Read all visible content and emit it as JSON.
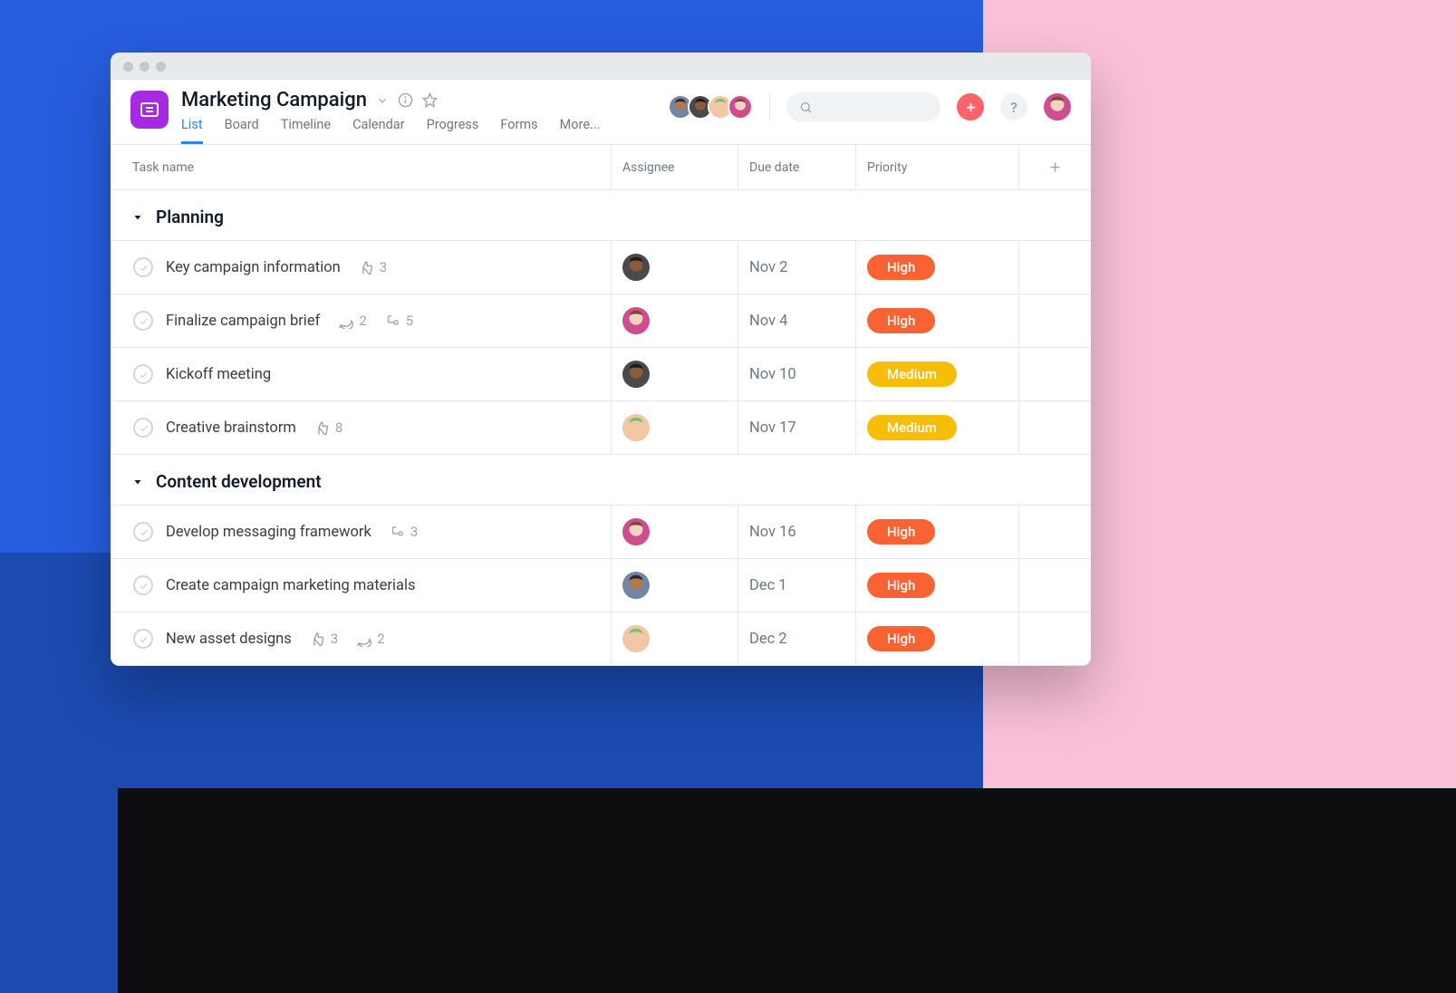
{
  "project": {
    "title": "Marketing Campaign",
    "icon_color": "#A62AE3"
  },
  "tabs": [
    {
      "label": "List",
      "active": true
    },
    {
      "label": "Board",
      "active": false
    },
    {
      "label": "Timeline",
      "active": false
    },
    {
      "label": "Calendar",
      "active": false
    },
    {
      "label": "Progress",
      "active": false
    },
    {
      "label": "Forms",
      "active": false
    },
    {
      "label": "More...",
      "active": false
    }
  ],
  "header_avatars": [
    {
      "skin": "#B17A4E",
      "shirt": "#7385A5",
      "hair": "#2F2A28"
    },
    {
      "skin": "#8A5A3A",
      "shirt": "#4A4A4A",
      "hair": "#1E1A18"
    },
    {
      "skin": "#F1C7A4",
      "shirt": "#F1C7A4",
      "hair": "#7DBF6B"
    },
    {
      "skin": "#F3D3BF",
      "shirt": "#CF4D8F",
      "hair": "#7A4A3A"
    }
  ],
  "me_avatar": {
    "skin": "#F3D3BF",
    "shirt": "#CF4D8F",
    "hair": "#7A4A3A"
  },
  "help_label": "?",
  "columns": {
    "task": "Task name",
    "assignee": "Assignee",
    "due": "Due date",
    "priority": "Priority"
  },
  "priority_colors": {
    "High": "#F96232",
    "Medium": "#F6BE06"
  },
  "sections": [
    {
      "name": "Planning",
      "tasks": [
        {
          "name": "Key campaign information",
          "likes": 3,
          "comments": null,
          "subtasks": null,
          "assignee": {
            "skin": "#8A5A3A",
            "shirt": "#4A4A4A",
            "hair": "#1E1A18"
          },
          "due": "Nov 2",
          "priority": "High"
        },
        {
          "name": "Finalize campaign brief",
          "likes": null,
          "comments": 2,
          "subtasks": 5,
          "assignee": {
            "skin": "#F3D3BF",
            "shirt": "#CF4D8F",
            "hair": "#7A4A3A"
          },
          "due": "Nov 4",
          "priority": "High"
        },
        {
          "name": "Kickoff meeting",
          "likes": null,
          "comments": null,
          "subtasks": null,
          "assignee": {
            "skin": "#8A5A3A",
            "shirt": "#4A4A4A",
            "hair": "#1E1A18"
          },
          "due": "Nov 10",
          "priority": "Medium"
        },
        {
          "name": "Creative brainstorm",
          "likes": 8,
          "comments": null,
          "subtasks": null,
          "assignee": {
            "skin": "#F1C7A4",
            "shirt": "#F1C7A4",
            "hair": "#7DBF6B"
          },
          "due": "Nov 17",
          "priority": "Medium"
        }
      ]
    },
    {
      "name": "Content development",
      "tasks": [
        {
          "name": "Develop messaging framework",
          "likes": null,
          "comments": null,
          "subtasks": 3,
          "assignee": {
            "skin": "#F3D3BF",
            "shirt": "#CF4D8F",
            "hair": "#7A4A3A"
          },
          "due": "Nov 16",
          "priority": "High"
        },
        {
          "name": "Create campaign marketing materials",
          "likes": null,
          "comments": null,
          "subtasks": null,
          "assignee": {
            "skin": "#B17A4E",
            "shirt": "#7385A5",
            "hair": "#2F2A28"
          },
          "due": "Dec 1",
          "priority": "High"
        },
        {
          "name": "New asset designs",
          "likes": 3,
          "comments": 2,
          "subtasks": null,
          "assignee": {
            "skin": "#F1C7A4",
            "shirt": "#F1C7A4",
            "hair": "#7DBF6B"
          },
          "due": "Dec 2",
          "priority": "High"
        }
      ]
    }
  ]
}
